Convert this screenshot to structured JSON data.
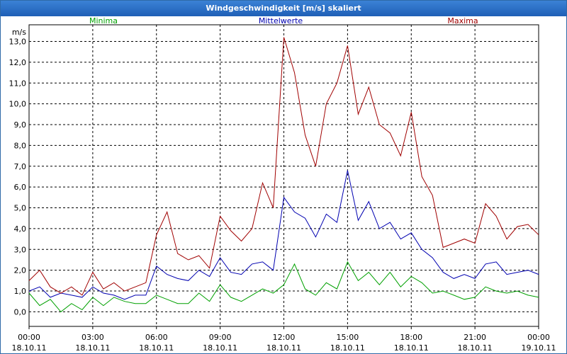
{
  "window": {
    "title": "Windgeschwindigkeit [m/s] skaliert"
  },
  "chart_data": {
    "type": "line",
    "title": "Windgeschwindigkeit [m/s] skaliert",
    "ylabel": "m/s",
    "ylim": [
      -0.7,
      13.8
    ],
    "grid": true,
    "legend": "top",
    "yticks": [
      "0,0",
      "1,0",
      "2,0",
      "3,0",
      "4,0",
      "5,0",
      "6,0",
      "7,0",
      "8,0",
      "9,0",
      "10,0",
      "11,0",
      "12,0",
      "13,0"
    ],
    "xticks": [
      {
        "time": "00:00",
        "date": "18.10.11"
      },
      {
        "time": "03:00",
        "date": "18.10.11"
      },
      {
        "time": "06:00",
        "date": "18.10.11"
      },
      {
        "time": "09:00",
        "date": "18.10.11"
      },
      {
        "time": "12:00",
        "date": "18.10.11"
      },
      {
        "time": "15:00",
        "date": "18.10.11"
      },
      {
        "time": "18:00",
        "date": "18.10.11"
      },
      {
        "time": "21:00",
        "date": "18.10.11"
      },
      {
        "time": "00:00",
        "date": "19.10.11"
      }
    ],
    "x_hours": [
      0,
      0.5,
      1,
      1.5,
      2,
      2.5,
      3,
      3.5,
      4,
      4.5,
      5,
      5.5,
      6,
      6.5,
      7,
      7.5,
      8,
      8.5,
      9,
      9.5,
      10,
      10.5,
      11,
      11.5,
      12,
      12.5,
      13,
      13.5,
      14,
      14.5,
      15,
      15.5,
      16,
      16.5,
      17,
      17.5,
      18,
      18.5,
      19,
      19.5,
      20,
      20.5,
      21,
      21.5,
      22,
      22.5,
      23,
      23.5,
      24
    ],
    "series": [
      {
        "name": "Minima",
        "color": "#00a000",
        "values": [
          0.9,
          0.3,
          0.6,
          0.0,
          0.4,
          0.1,
          0.7,
          0.3,
          0.7,
          0.5,
          0.4,
          0.4,
          0.8,
          0.6,
          0.4,
          0.4,
          0.9,
          0.5,
          1.3,
          0.7,
          0.5,
          0.8,
          1.1,
          0.9,
          1.3,
          2.3,
          1.1,
          0.8,
          1.4,
          1.1,
          2.4,
          1.5,
          1.9,
          1.3,
          1.9,
          1.2,
          1.7,
          1.4,
          0.9,
          1.0,
          0.8,
          0.6,
          0.7,
          1.2,
          1.0,
          0.9,
          1.0,
          0.8,
          0.7
        ]
      },
      {
        "name": "Mittelwerte",
        "color": "#0000b0",
        "values": [
          1.0,
          1.2,
          0.7,
          0.9,
          0.8,
          0.7,
          1.2,
          0.9,
          0.8,
          0.6,
          0.8,
          0.8,
          2.2,
          1.8,
          1.6,
          1.5,
          2.0,
          1.7,
          2.6,
          1.9,
          1.8,
          2.3,
          2.4,
          2.0,
          5.5,
          4.8,
          4.5,
          3.6,
          4.7,
          4.3,
          6.8,
          4.4,
          5.3,
          4.0,
          4.3,
          3.5,
          3.8,
          3.0,
          2.6,
          1.9,
          1.6,
          1.8,
          1.6,
          2.3,
          2.4,
          1.8,
          1.9,
          2.0,
          1.8
        ]
      },
      {
        "name": "Maxima",
        "color": "#a00000",
        "values": [
          1.5,
          2.0,
          1.2,
          0.9,
          1.2,
          0.8,
          1.9,
          1.1,
          1.4,
          1.0,
          1.2,
          1.4,
          3.7,
          4.8,
          2.8,
          2.5,
          2.7,
          2.1,
          4.6,
          3.9,
          3.4,
          4.0,
          6.2,
          5.0,
          13.2,
          11.5,
          8.5,
          7.0,
          10.0,
          11.0,
          12.8,
          9.5,
          10.8,
          9.0,
          8.6,
          7.5,
          9.6,
          6.5,
          5.6,
          3.1,
          3.3,
          3.5,
          3.3,
          5.2,
          4.6,
          3.5,
          4.1,
          4.2,
          3.7
        ]
      }
    ]
  }
}
